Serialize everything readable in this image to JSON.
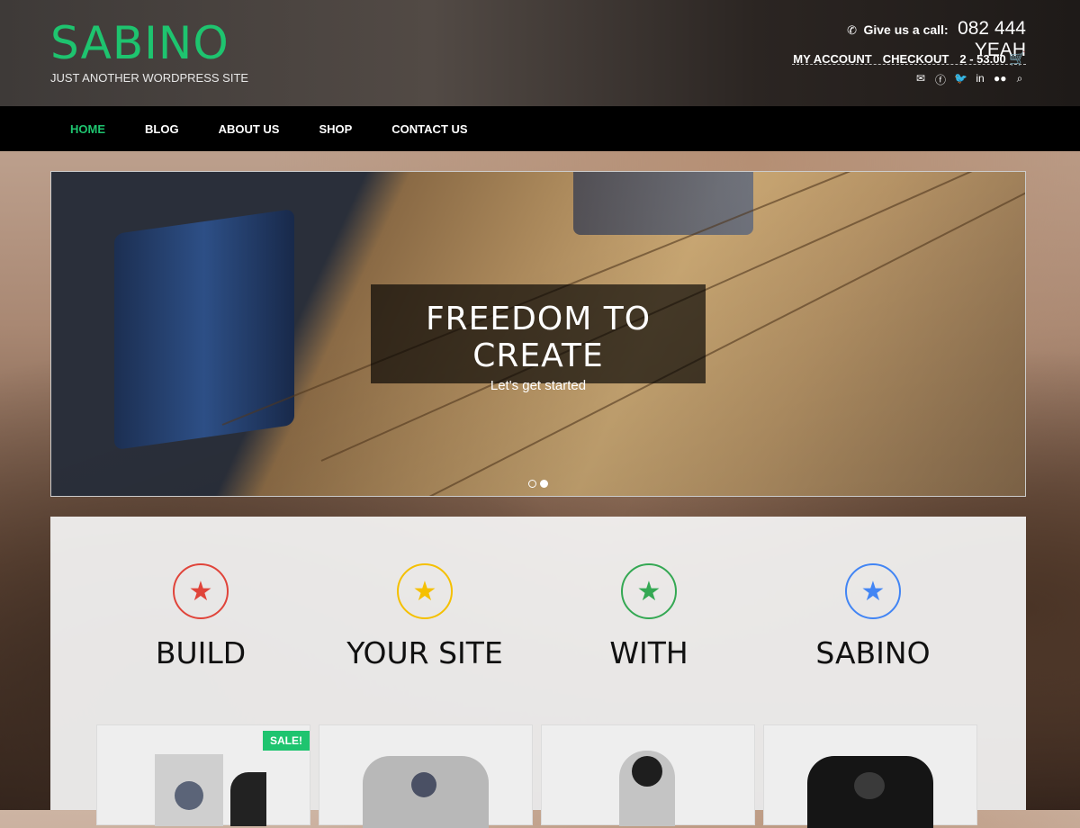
{
  "site": {
    "title": "SABINO",
    "tagline": "JUST ANOTHER WORDPRESS SITE"
  },
  "contact": {
    "label": "Give us a call:",
    "phone": "082 444 YEAH"
  },
  "account": {
    "my_account": "MY ACCOUNT",
    "checkout": "CHECKOUT",
    "cart_summary": "2 - 53.00"
  },
  "social_icons": [
    "envelope-icon",
    "facebook-icon",
    "twitter-icon",
    "linkedin-icon",
    "flickr-icon",
    "search-icon"
  ],
  "nav": {
    "items": [
      {
        "label": "HOME",
        "active": true
      },
      {
        "label": "BLOG",
        "active": false
      },
      {
        "label": "ABOUT US",
        "active": false
      },
      {
        "label": "SHOP",
        "active": false
      },
      {
        "label": "CONTACT US",
        "active": false
      }
    ]
  },
  "slider": {
    "title": "FREEDOM TO CREATE",
    "subtitle": "Let's get started",
    "slide_count": 2,
    "active_slide": 2
  },
  "features": [
    {
      "label": "BUILD",
      "color": "#e0443a"
    },
    {
      "label": "YOUR SITE",
      "color": "#f5c000"
    },
    {
      "label": "WITH",
      "color": "#34a853"
    },
    {
      "label": "SABINO",
      "color": "#4285f4"
    }
  ],
  "products": [
    {
      "badge": "SALE!",
      "image": "ninja-poster"
    },
    {
      "image": "grey-ninja-tshirt"
    },
    {
      "image": "grey-hoodie"
    },
    {
      "image": "black-tshirt"
    }
  ],
  "colors": {
    "accent": "#1ec46f"
  }
}
